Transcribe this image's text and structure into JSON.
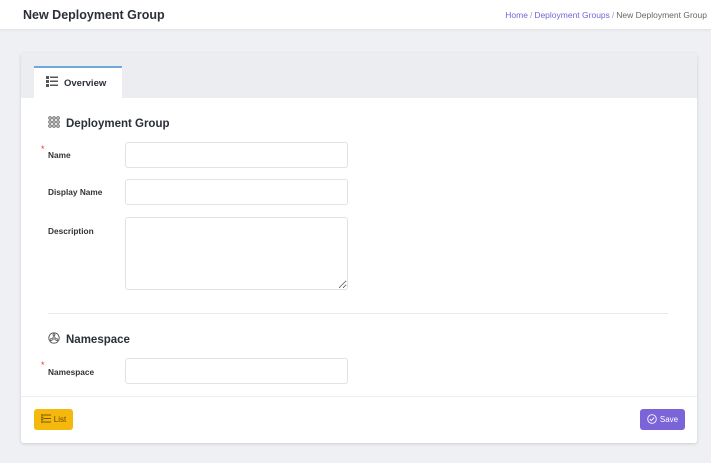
{
  "header": {
    "page_title": "New Deployment Group",
    "breadcrumb": {
      "home": "Home",
      "separator": "/",
      "parent": "Deployment Groups",
      "current": "New Deployment Group"
    }
  },
  "tabs": [
    {
      "label": "Overview",
      "icon": "list-icon",
      "active": true
    }
  ],
  "sections": {
    "deployment_group": {
      "title": "Deployment Group",
      "icon": "grid-dots-icon",
      "fields": {
        "name": {
          "label": "Name",
          "required_mark": "*",
          "value": "",
          "placeholder": ""
        },
        "display_name": {
          "label": "Display Name",
          "value": "",
          "placeholder": ""
        },
        "description": {
          "label": "Description",
          "value": "",
          "placeholder": ""
        }
      }
    },
    "namespace": {
      "title": "Namespace",
      "icon": "network-icon",
      "fields": {
        "namespace": {
          "label": "Namespace",
          "required_mark": "*",
          "value": "",
          "placeholder": ""
        }
      }
    }
  },
  "footer": {
    "list_label": "List",
    "list_icon": "list-icon",
    "save_label": "Save",
    "save_icon": "check-circle-icon"
  },
  "colors": {
    "accent": "#7a64d8",
    "list_button": "#f5b80c",
    "required": "#e03c31",
    "link": "#7067d8",
    "tab_border": "#6fa8dc"
  }
}
